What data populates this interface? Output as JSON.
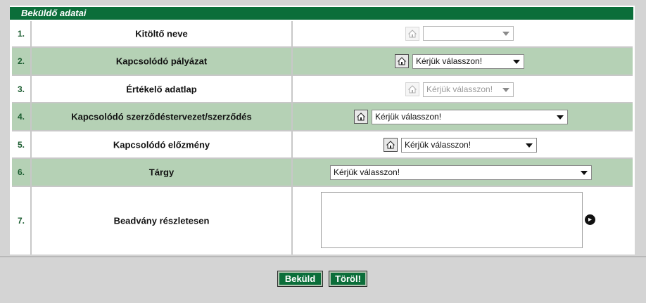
{
  "section": {
    "title": "Beküldő adatai"
  },
  "rows": [
    {
      "num": "1.",
      "label": "Kitöltő neve",
      "value": ""
    },
    {
      "num": "2.",
      "label": "Kapcsolódó pályázat",
      "value": "Kérjük válasszon!"
    },
    {
      "num": "3.",
      "label": "Értékelő adatlap",
      "value": "Kérjük válasszon!"
    },
    {
      "num": "4.",
      "label": "Kapcsolódó szerződéstervezet/szerződés",
      "value": "Kérjük válasszon!"
    },
    {
      "num": "5.",
      "label": "Kapcsolódó előzmény",
      "value": "Kérjük válasszon!"
    },
    {
      "num": "6.",
      "label": "Tárgy",
      "value": "Kérjük válasszon!"
    },
    {
      "num": "7.",
      "label": "Beadvány részletesen",
      "value": ""
    }
  ],
  "actions": {
    "submit_label": "Beküld",
    "delete_label": "Töröl!"
  },
  "colors": {
    "accent": "#0b6e3a",
    "row_alt": "#b5d1b5",
    "background": "#d4d4d4"
  },
  "icons": {
    "picker": "home-icon",
    "go": "arrow-right-circle-icon"
  }
}
